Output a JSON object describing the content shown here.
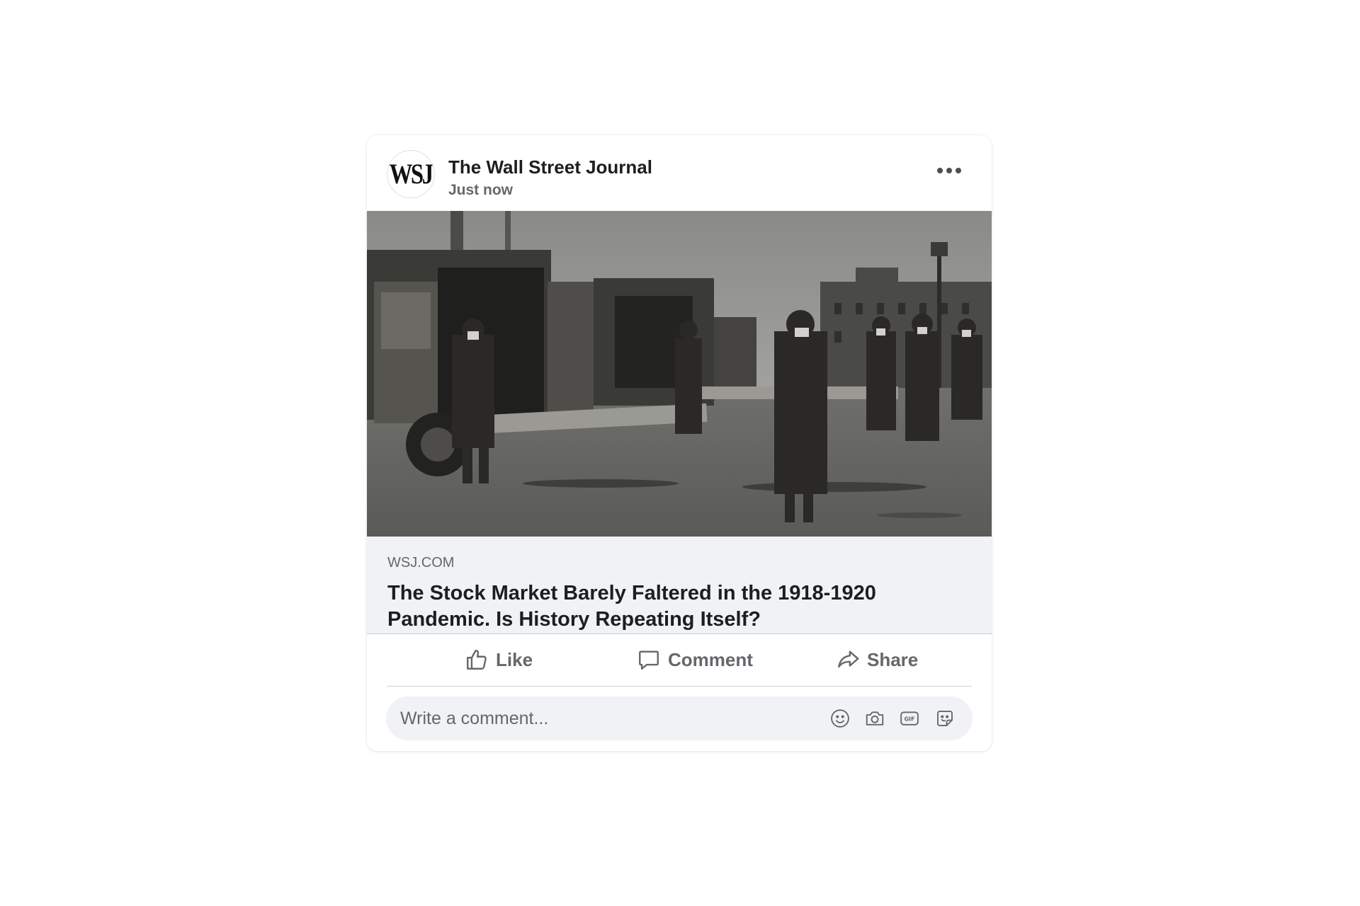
{
  "post": {
    "page_name": "The Wall Street Journal",
    "avatar_text": "WSJ",
    "time": "Just now"
  },
  "link": {
    "domain": "WSJ.COM",
    "title": "The Stock Market Barely Faltered in the 1918-1920 Pandemic. Is History Repeating Itself?"
  },
  "actions": {
    "like": "Like",
    "comment": "Comment",
    "share": "Share"
  },
  "comment_box": {
    "placeholder": "Write a comment..."
  },
  "icons": {
    "more": "more-options-icon",
    "like": "thumbs-up-icon",
    "comment": "speech-bubble-icon",
    "share": "share-arrow-icon",
    "emoji": "smiley-icon",
    "camera": "camera-icon",
    "gif": "gif-icon",
    "sticker": "sticker-icon"
  },
  "colors": {
    "text_primary": "#1c1e21",
    "text_secondary": "#65676b",
    "surface": "#f0f2f5",
    "divider": "#ced0d4"
  }
}
